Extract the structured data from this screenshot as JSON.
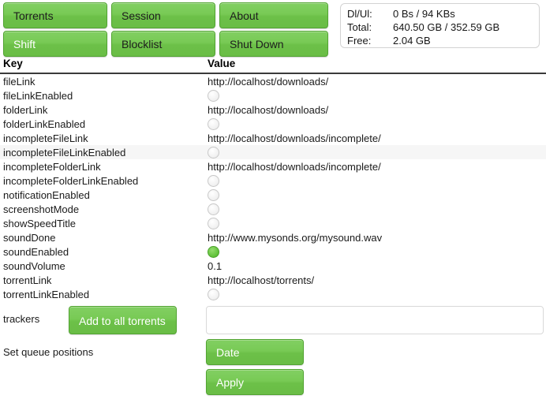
{
  "toolbar": {
    "buttons": [
      {
        "label": "Torrents",
        "white_text": false
      },
      {
        "label": "Session",
        "white_text": false
      },
      {
        "label": "About",
        "white_text": false
      },
      {
        "label": "Shift",
        "white_text": true
      },
      {
        "label": "Blocklist",
        "white_text": false
      },
      {
        "label": "Shut Down",
        "white_text": false
      }
    ]
  },
  "stats": {
    "rows": [
      {
        "label": "Dl/Ul:",
        "value": "0 Bs / 94 KBs"
      },
      {
        "label": "Total:",
        "value": "640.50 GB / 352.59 GB"
      },
      {
        "label": "Free:",
        "value": "2.04 GB"
      }
    ]
  },
  "table": {
    "headers": {
      "key": "Key",
      "value": "Value"
    },
    "rows": [
      {
        "key": "fileLink",
        "type": "text",
        "value": "http://localhost/downloads/",
        "highlight": false
      },
      {
        "key": "fileLinkEnabled",
        "type": "toggle",
        "value": "off",
        "highlight": false
      },
      {
        "key": "folderLink",
        "type": "text",
        "value": "http://localhost/downloads/",
        "highlight": false
      },
      {
        "key": "folderLinkEnabled",
        "type": "toggle",
        "value": "off",
        "highlight": false
      },
      {
        "key": "incompleteFileLink",
        "type": "text",
        "value": "http://localhost/downloads/incomplete/",
        "highlight": false
      },
      {
        "key": "incompleteFileLinkEnabled",
        "type": "toggle",
        "value": "off",
        "highlight": true
      },
      {
        "key": "incompleteFolderLink",
        "type": "text",
        "value": "http://localhost/downloads/incomplete/",
        "highlight": false
      },
      {
        "key": "incompleteFolderLinkEnabled",
        "type": "toggle",
        "value": "off",
        "highlight": false
      },
      {
        "key": "notificationEnabled",
        "type": "toggle",
        "value": "off",
        "highlight": false
      },
      {
        "key": "screenshotMode",
        "type": "toggle",
        "value": "off",
        "highlight": false
      },
      {
        "key": "showSpeedTitle",
        "type": "toggle",
        "value": "off",
        "highlight": false
      },
      {
        "key": "soundDone",
        "type": "text",
        "value": "http://www.mysonds.org/mysound.wav",
        "highlight": false
      },
      {
        "key": "soundEnabled",
        "type": "toggle",
        "value": "on",
        "highlight": false
      },
      {
        "key": "soundVolume",
        "type": "text",
        "value": "0.1",
        "highlight": false
      },
      {
        "key": "torrentLink",
        "type": "text",
        "value": "http://localhost/torrents/",
        "highlight": false
      },
      {
        "key": "torrentLinkEnabled",
        "type": "toggle",
        "value": "off",
        "highlight": false
      }
    ]
  },
  "form": {
    "trackers_label": "trackers",
    "add_trackers_button": "Add to all torrents",
    "trackers_input_value": "",
    "trackers_input_placeholder": "",
    "queue_label": "Set queue positions",
    "date_button": "Date",
    "apply_button": "Apply"
  },
  "colors": {
    "accent_green": "#6cc048",
    "accent_green_light": "#82cf62",
    "accent_border": "#52a432",
    "toggle_on": "#63c33c"
  }
}
